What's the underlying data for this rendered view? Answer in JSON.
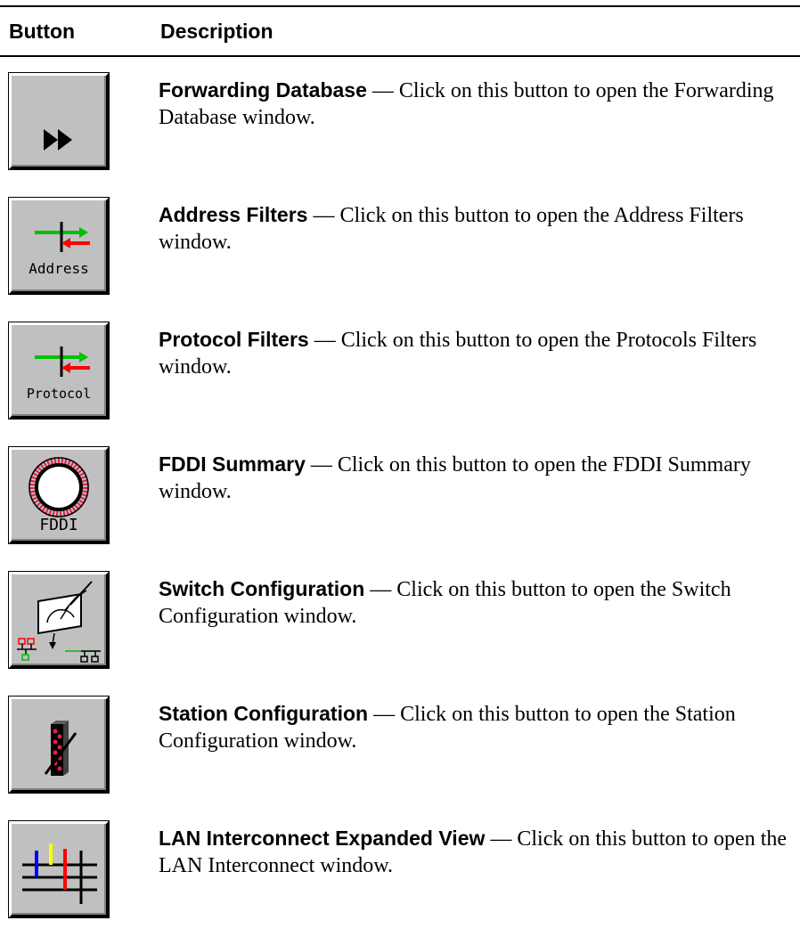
{
  "header": {
    "col_button": "Button",
    "col_description": "Description"
  },
  "rows": [
    {
      "term": "Forwarding Database",
      "sep": " — ",
      "text": "Click on this button to open the Forwarding Database window.",
      "icon": "fast-forward-icon"
    },
    {
      "term": "Address Filters",
      "sep": " — ",
      "text": "Click on this button to open the Address Filters window.",
      "icon": "address-filter-icon",
      "icon_label": "Address"
    },
    {
      "term": "Protocol Filters",
      "sep": " — ",
      "text": "Click on this button to open the Protocols Filters window.",
      "icon": "protocol-filter-icon",
      "icon_label": "Protocol"
    },
    {
      "term": "FDDI Summary",
      "sep": " — ",
      "text": "Click on this button to open the FDDI Summary window.",
      "icon": "fddi-ring-icon",
      "icon_label": "FDDI"
    },
    {
      "term": "Switch Configuration",
      "sep": " — ",
      "text": "Click on this button to open the Switch Configuration window.",
      "icon": "switch-config-icon"
    },
    {
      "term": "Station Configuration",
      "sep": " — ",
      "text": "Click on this button to open the Station Configuration window.",
      "icon": "station-config-icon"
    },
    {
      "term": "LAN Interconnect Expanded View",
      "sep": " — ",
      "text": "Click on this button to open the LAN Interconnect window.",
      "icon": "lan-interconnect-icon"
    }
  ],
  "colors": {
    "button_face": "#c0c0c0",
    "arrow_green": "#00c000",
    "arrow_red": "#ff0000",
    "ring_red": "#e0204a",
    "lan_blue": "#0000ff",
    "lan_yellow": "#ffff00",
    "lan_red": "#ff0000"
  }
}
